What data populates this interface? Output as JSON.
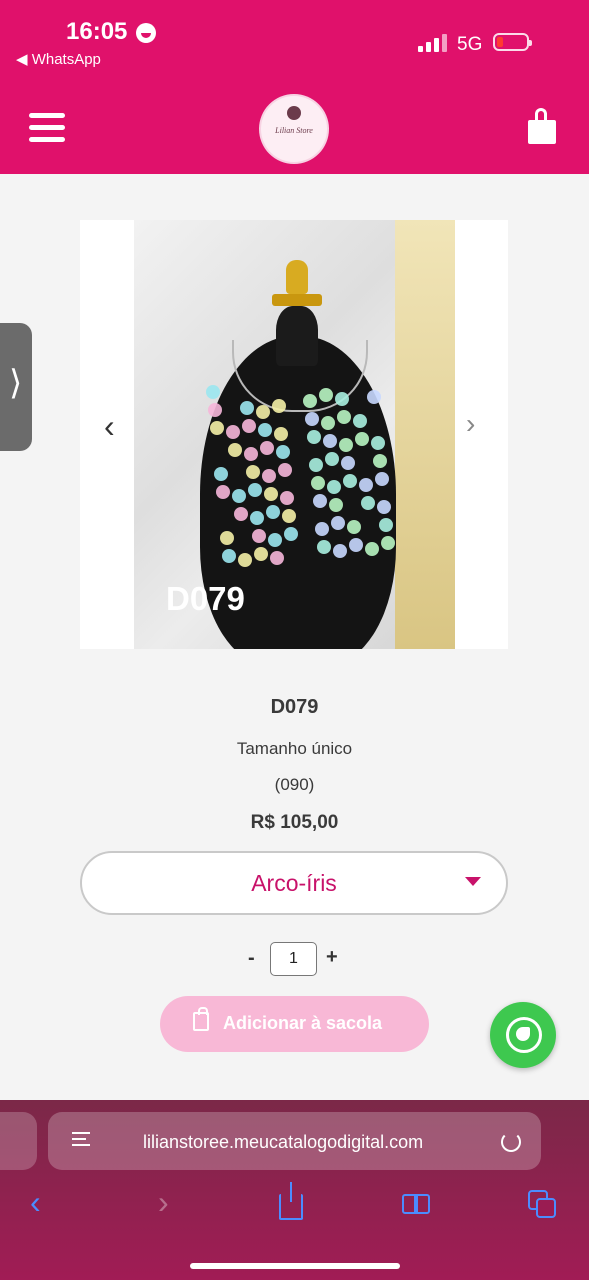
{
  "status": {
    "time": "16:05",
    "back_app": "◀ WhatsApp",
    "network": "5G"
  },
  "header": {
    "brand_color": "#e0116b",
    "logo_text": "Lilian Store"
  },
  "carousel": {
    "photo_label": "D079",
    "prev_icon": "‹",
    "next_icon": "›"
  },
  "side_tab": {
    "icon": "⟩"
  },
  "product": {
    "title": "D079",
    "size": "Tamanho único",
    "code": "(090)",
    "price": "R$ 105,00",
    "variant": {
      "selected": "Arco-íris"
    },
    "quantity": "1",
    "minus": "-",
    "plus": "+",
    "add_to_bag": "Adicionar à sacola"
  },
  "browser": {
    "url": "lilianstoree.meucatalogodigital.com",
    "back": "‹",
    "forward": "›"
  },
  "colors": {
    "accent": "#e0116b",
    "variant_text": "#c8126a",
    "add_button": "#f8b8d6",
    "whatsapp": "#3ec84f",
    "browser_icons": "#4b8cff"
  }
}
